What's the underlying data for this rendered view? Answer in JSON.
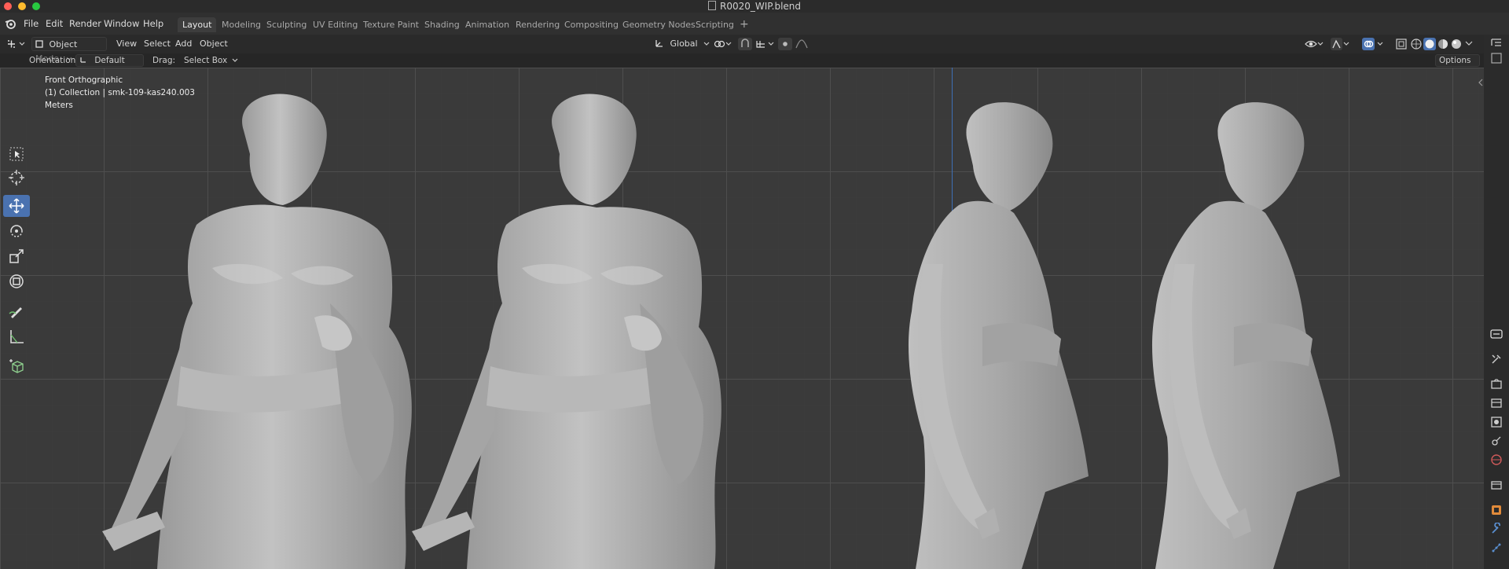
{
  "window": {
    "title": "R0020_WIP.blend"
  },
  "menu": [
    "File",
    "Edit",
    "Render",
    "Window",
    "Help"
  ],
  "workspaces": [
    {
      "label": "Layout",
      "active": true
    },
    {
      "label": "Modeling",
      "active": false
    },
    {
      "label": "Sculpting",
      "active": false
    },
    {
      "label": "UV Editing",
      "active": false
    },
    {
      "label": "Texture Paint",
      "active": false
    },
    {
      "label": "Shading",
      "active": false
    },
    {
      "label": "Animation",
      "active": false
    },
    {
      "label": "Rendering",
      "active": false
    },
    {
      "label": "Compositing",
      "active": false
    },
    {
      "label": "Geometry Nodes",
      "active": false
    },
    {
      "label": "Scripting",
      "active": false
    }
  ],
  "add_workspace_label": "+",
  "header": {
    "mode": "Object Mode",
    "menus": [
      "View",
      "Select",
      "Add",
      "Object"
    ],
    "transform_orientation": "Global"
  },
  "tool_settings": {
    "orientation_label": "Orientation:",
    "orientation_value": "Default",
    "drag_label": "Drag:",
    "drag_value": "Select Box",
    "options_label": "Options"
  },
  "viewport_info": {
    "view": "Front Orthographic",
    "collection": "(1) Collection | smk-109-kas240.003",
    "units": "Meters"
  },
  "toolbar_tools": [
    "select-box",
    "cursor",
    "move",
    "rotate",
    "scale",
    "transform",
    "annotate",
    "measure",
    "add-cube"
  ],
  "active_tool": "move",
  "colors": {
    "accent": "#4a72b0",
    "viewport_bg": "#3a3a3a",
    "mesh": "#a9a9a9"
  }
}
